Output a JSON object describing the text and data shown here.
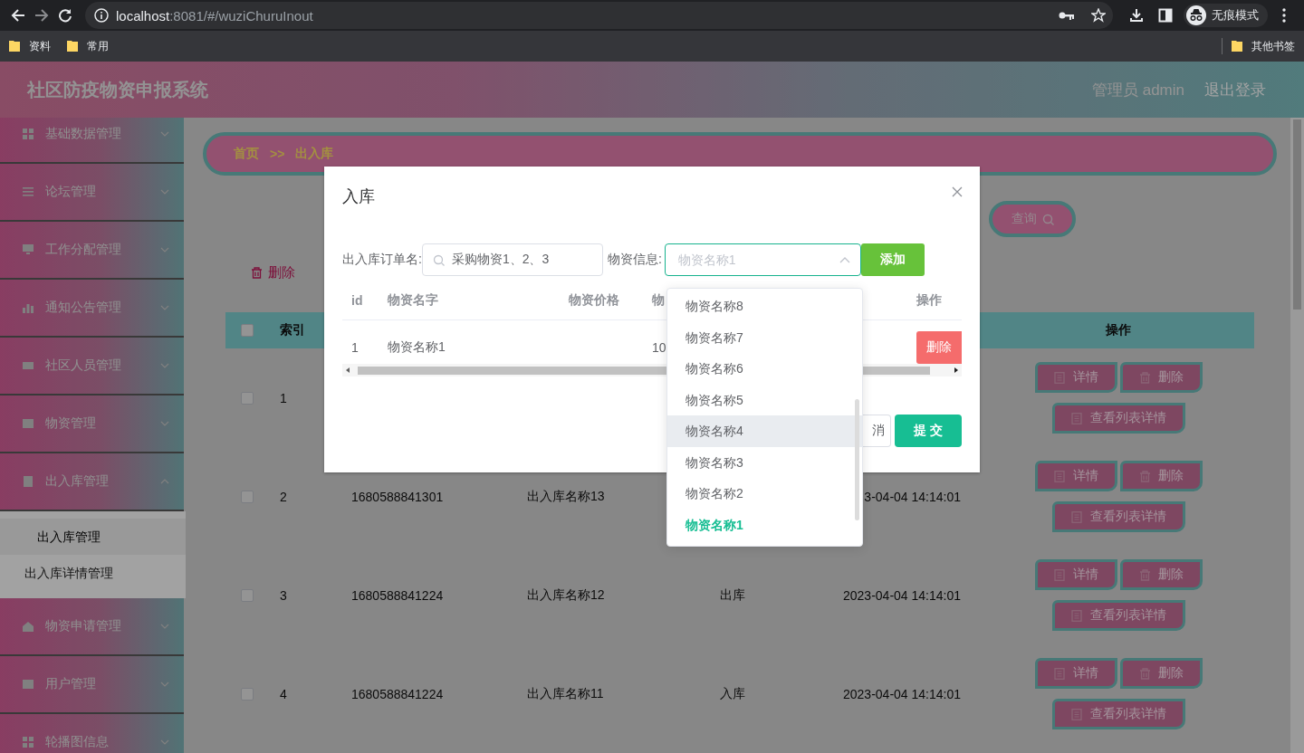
{
  "browser": {
    "url_host": "localhost",
    "url_rest": ":8081/#/wuziChuruInout",
    "incognito_label": "无痕模式",
    "bookmarks": [
      {
        "label": "资料"
      },
      {
        "label": "常用"
      }
    ],
    "other_bookmarks": "其他书签"
  },
  "header": {
    "title": "社区防疫物资申报系统",
    "user": "管理员 admin",
    "logout": "退出登录"
  },
  "sidebar": {
    "items": [
      {
        "label": "基础数据管理",
        "kind": "grid",
        "expanded": false
      },
      {
        "label": "论坛管理",
        "kind": "lines",
        "expanded": false
      },
      {
        "label": "工作分配管理",
        "kind": "monitor",
        "expanded": false
      },
      {
        "label": "通知公告管理",
        "kind": "bars",
        "expanded": false
      },
      {
        "label": "社区人员管理",
        "kind": "people",
        "expanded": false
      },
      {
        "label": "物资管理",
        "kind": "box",
        "expanded": false
      },
      {
        "label": "出入库管理",
        "kind": "doc",
        "expanded": true,
        "children": [
          {
            "label": "出入库管理",
            "selected": true
          },
          {
            "label": "出入库详情管理",
            "selected": false
          }
        ]
      },
      {
        "label": "物资申请管理",
        "kind": "house",
        "expanded": false
      },
      {
        "label": "用户管理",
        "kind": "box",
        "expanded": false
      },
      {
        "label": "轮播图信息",
        "kind": "grid",
        "expanded": false
      }
    ]
  },
  "breadcrumb": [
    "首页",
    ">>",
    "出入库"
  ],
  "query_button": "查询",
  "delete_button": "删除",
  "table": {
    "select_all_checked": false,
    "columns": [
      "索引",
      "操作"
    ],
    "rows": [
      {
        "index": "1",
        "checked": false,
        "actions": [
          "详情",
          "删除",
          "查看列表详情"
        ]
      },
      {
        "index": "2",
        "checked": false,
        "order_no": "1680588841301",
        "name": "出入库名称13",
        "time": "3-04-04 14:14:01",
        "actions": [
          "详情",
          "删除",
          "查看列表详情"
        ]
      },
      {
        "index": "3",
        "checked": false,
        "order_no": "1680588841224",
        "name": "出入库名称12",
        "type": "出库",
        "time": "2023-04-04 14:14:01",
        "actions": [
          "详情",
          "删除",
          "查看列表详情"
        ]
      },
      {
        "index": "4",
        "checked": false,
        "order_no": "1680588841224",
        "name": "出入库名称11",
        "type": "入库",
        "time": "2023-04-04 14:14:01",
        "actions": [
          "详情",
          "删除",
          "查看列表详情"
        ]
      }
    ]
  },
  "modal": {
    "title": "入库",
    "order_label": "出入库订单名:",
    "order_value": "采购物资1、2、3",
    "material_label": "物资信息:",
    "material_placeholder": "物资名称1",
    "add_button": "添加",
    "columns": [
      "id",
      "物资名字",
      "物资价格",
      "物",
      "操作"
    ],
    "rows": [
      {
        "id": "1",
        "name": "物资名称1",
        "qty": "10",
        "action": "删除"
      }
    ],
    "cancel_button": "消",
    "submit_button": "提 交",
    "options": [
      {
        "label": "物资名称8",
        "selected": false,
        "hovered": false
      },
      {
        "label": "物资名称7",
        "selected": false,
        "hovered": false
      },
      {
        "label": "物资名称6",
        "selected": false,
        "hovered": false
      },
      {
        "label": "物资名称5",
        "selected": false,
        "hovered": false
      },
      {
        "label": "物资名称4",
        "selected": false,
        "hovered": true
      },
      {
        "label": "物资名称3",
        "selected": false,
        "hovered": false
      },
      {
        "label": "物资名称2",
        "selected": false,
        "hovered": false
      },
      {
        "label": "物资名称1",
        "selected": true,
        "hovered": false
      }
    ]
  }
}
